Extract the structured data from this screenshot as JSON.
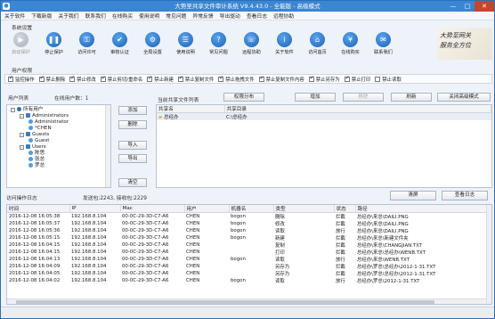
{
  "title": "大势至共享文件审计系统 V9.4.43.0 - 全能版 - 高级模式",
  "menu": [
    "关于软件",
    "下载新版",
    "关于我们",
    "联系我们",
    "在线购买",
    "使用说明",
    "常见问题",
    "异常反馈",
    "导出驱动",
    "查看日志",
    "远程协助"
  ],
  "sections": {
    "settings": "系统设置",
    "permissions": "用户权限",
    "user_list": "用户列表",
    "online": "在线用户数：1",
    "shared_list": "当前共享文件列表",
    "log": "访问操作日志",
    "packets": "发送包:2243, 接收包:2229"
  },
  "toolbar": [
    {
      "label": "启动保护",
      "icon": "play-icon",
      "glyph": "▶",
      "disabled": true
    },
    {
      "label": "停止保护",
      "icon": "pause-icon",
      "glyph": "❚❚",
      "disabled": false
    },
    {
      "label": "访问许可",
      "icon": "key-icon",
      "glyph": "⚿",
      "disabled": false
    },
    {
      "label": "审核认证",
      "icon": "shield-icon",
      "glyph": "✔",
      "disabled": false
    },
    {
      "label": "全局设置",
      "icon": "gear-icon",
      "glyph": "⚙",
      "disabled": false
    },
    {
      "label": "使用说明",
      "icon": "book-icon",
      "glyph": "☰",
      "disabled": false
    },
    {
      "label": "常见问题",
      "icon": "question-icon",
      "glyph": "?",
      "disabled": false
    },
    {
      "label": "远程协助",
      "icon": "headset-icon",
      "glyph": "☏",
      "disabled": false
    },
    {
      "label": "关于软件",
      "icon": "info-icon",
      "glyph": "i",
      "disabled": false
    },
    {
      "label": "访问首页",
      "icon": "home-icon",
      "glyph": "⌂",
      "disabled": false
    },
    {
      "label": "在线购买",
      "icon": "cart-icon",
      "glyph": "¥",
      "disabled": false
    },
    {
      "label": "联系我们",
      "icon": "contact-icon",
      "glyph": "✉",
      "disabled": false
    }
  ],
  "calligraphy": "大势至网关\n服务全方位",
  "permissions": [
    {
      "label": "监控操作",
      "checked": true
    },
    {
      "label": "禁止删除",
      "checked": true
    },
    {
      "label": "禁止修改",
      "checked": true
    },
    {
      "label": "禁止剪切/重命名",
      "checked": true
    },
    {
      "label": "禁止新建",
      "checked": true
    },
    {
      "label": "禁止复制文件",
      "checked": true
    },
    {
      "label": "禁止拖拽文件",
      "checked": true
    },
    {
      "label": "禁止复制文件内容",
      "checked": true
    },
    {
      "label": "禁止另存为",
      "checked": true
    },
    {
      "label": "禁止打印",
      "checked": true
    },
    {
      "label": "禁止读取",
      "checked": false
    }
  ],
  "tree": [
    {
      "label": "所有用户",
      "level": 0,
      "type": "all",
      "toggle": "-"
    },
    {
      "label": "Administrators",
      "level": 1,
      "type": "group",
      "toggle": "-"
    },
    {
      "label": "Administrator",
      "level": 2,
      "type": "user",
      "toggle": ""
    },
    {
      "label": "*CHEN",
      "level": 2,
      "type": "user",
      "toggle": ""
    },
    {
      "label": "Guests",
      "level": 1,
      "type": "group",
      "toggle": "-"
    },
    {
      "label": "Guest",
      "level": 2,
      "type": "user",
      "toggle": ""
    },
    {
      "label": "Users",
      "level": 1,
      "type": "group",
      "toggle": "-"
    },
    {
      "label": "陈思",
      "level": 2,
      "type": "user",
      "toggle": ""
    },
    {
      "label": "张总",
      "level": 2,
      "type": "user",
      "toggle": ""
    },
    {
      "label": "罗总",
      "level": 2,
      "type": "user",
      "toggle": ""
    }
  ],
  "user_buttons": {
    "add": "添加",
    "delete": "删除",
    "import": "导入",
    "export": "导出",
    "clear": "清空"
  },
  "share_buttons": {
    "perm_dist": "权限分布",
    "add": "增加",
    "remove": "移除",
    "refresh": "刷新",
    "close_adv": "关闭高级模式"
  },
  "share_headers": [
    "共享名",
    "共享目录"
  ],
  "shares": [
    {
      "name": "总经办",
      "dir": "C:\\总经办"
    }
  ],
  "log_buttons": {
    "clear": "清屏",
    "view": "查看日志"
  },
  "log_headers": [
    "时间",
    "IP",
    "Mac",
    "用户",
    "机器名",
    "类型",
    "状态",
    "路径"
  ],
  "log_rows": [
    [
      "2016-12-08 16:05:38",
      "192.168.8.104",
      "00-0C-29-3D-C7-A6",
      "CHEN",
      "bogon",
      "删除",
      "拦截",
      "总经办\\来总\\DAILI.PNG"
    ],
    [
      "2016-12-08 16:05:37",
      "192.168.8.104",
      "00-0C-29-3D-C7-A6",
      "CHEN",
      "bogon",
      "修改",
      "拦截",
      "总经办\\来总\\DAILI.PNG"
    ],
    [
      "2016-12-08 16:05:36",
      "192.168.8.104",
      "00-0C-29-3D-C7-A6",
      "CHEN",
      "bogon",
      "读取",
      "放行",
      "总经办\\来总\\DAILI.PNG"
    ],
    [
      "2016-12-08 16:05:15",
      "192.168.8.104",
      "00-0C-29-3D-C7-A6",
      "CHEN",
      "bogon",
      "新建",
      "拦截",
      "总经办\\来总\\新建文件夹"
    ],
    [
      "2016-12-08 16:04:15",
      "192.168.8.104",
      "00-0C-29-3D-C7-A6",
      "CHEN",
      "",
      "复制",
      "拦截",
      "总经办\\来总\\CHANGJIAN.TXT"
    ],
    [
      "2016-12-08 16:04:15",
      "192.168.8.104",
      "00-0C-29-3D-C7-A6",
      "CHEN",
      "",
      "打印",
      "拦截",
      "总经办\\来总\\总经办\\WENB.TXT"
    ],
    [
      "2016-12-08 16:04:13",
      "192.168.8.104",
      "00-0C-29-3D-C7-A6",
      "CHEN",
      "bogon",
      "读取",
      "放行",
      "总经办\\来总\\WENB.TXT"
    ],
    [
      "2016-12-08 16:04:09",
      "192.168.8.104",
      "00-0C-29-3D-C7-A6",
      "CHEN",
      "",
      "另存为",
      "拦截",
      "总经办\\罗总\\总经办\\2012-1-31.TXT"
    ],
    [
      "2016-12-08 16:04:05",
      "192.168.8.104",
      "00-0C-29-3D-C7-A6",
      "CHEN",
      "",
      "另存为",
      "拦截",
      "总经办\\罗总\\总经办\\2012-1-31.TXT"
    ],
    [
      "2016-12-08 16:04:02",
      "192.168.8.104",
      "00-0C-29-3D-C7-A6",
      "CHEN",
      "bogon",
      "读取",
      "放行",
      "总经办\\罗总\\2012-1-31.TXT"
    ]
  ]
}
